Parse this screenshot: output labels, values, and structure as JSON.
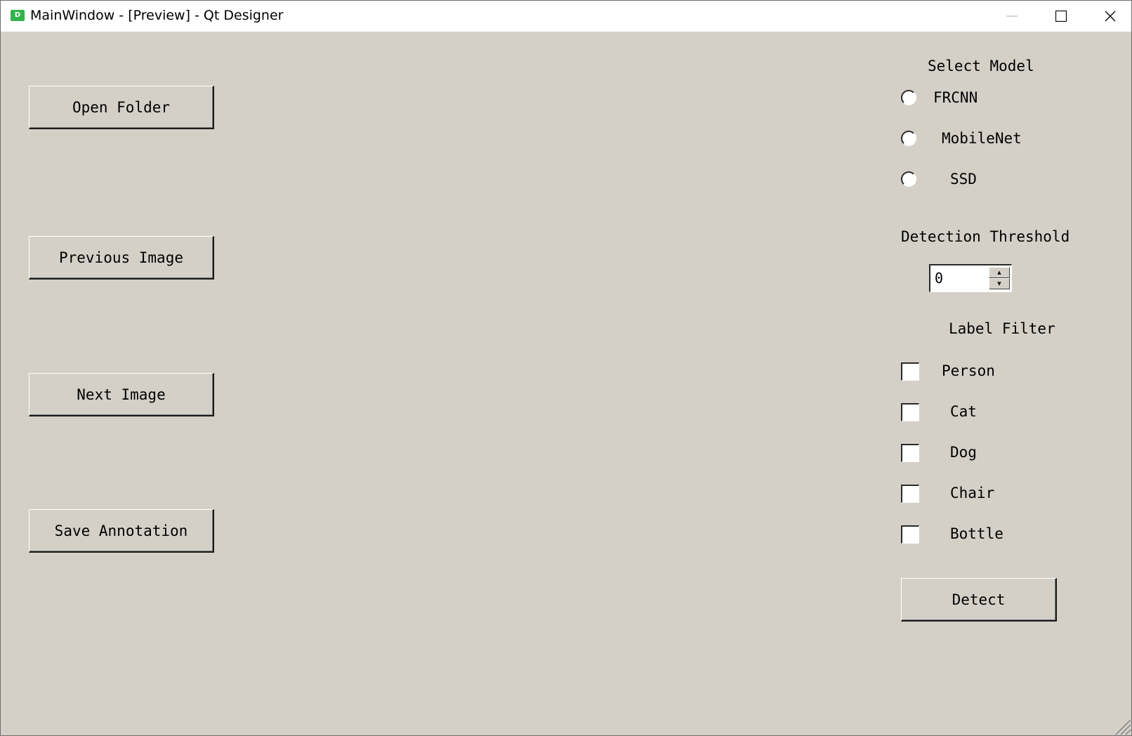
{
  "window": {
    "title": "MainWindow - [Preview] - Qt Designer",
    "app_icon_letter": "D",
    "controls": [
      "minimize-icon",
      "maximize-icon",
      "close-icon"
    ]
  },
  "left_panel": {
    "open_folder": "Open Folder",
    "previous_image": "Previous Image",
    "next_image": "Next Image",
    "save_annotation": "Save Annotation"
  },
  "right_panel": {
    "select_model_label": "Select Model",
    "models": [
      {
        "label": "FRCNN",
        "checked": false
      },
      {
        "label": "MobileNet",
        "checked": false
      },
      {
        "label": "SSD",
        "checked": false
      }
    ],
    "threshold_label": "Detection Threshold",
    "threshold_value": "0",
    "label_filter_label": "Label Filter",
    "filters": [
      {
        "label": "Person",
        "checked": false
      },
      {
        "label": "Cat",
        "checked": false
      },
      {
        "label": "Dog",
        "checked": false
      },
      {
        "label": "Chair",
        "checked": false
      },
      {
        "label": "Bottle",
        "checked": false
      }
    ],
    "detect": "Detect"
  },
  "colors": {
    "background": "#d4d0c8",
    "titlebar": "#ffffff",
    "app_icon": "#2fb44a"
  }
}
